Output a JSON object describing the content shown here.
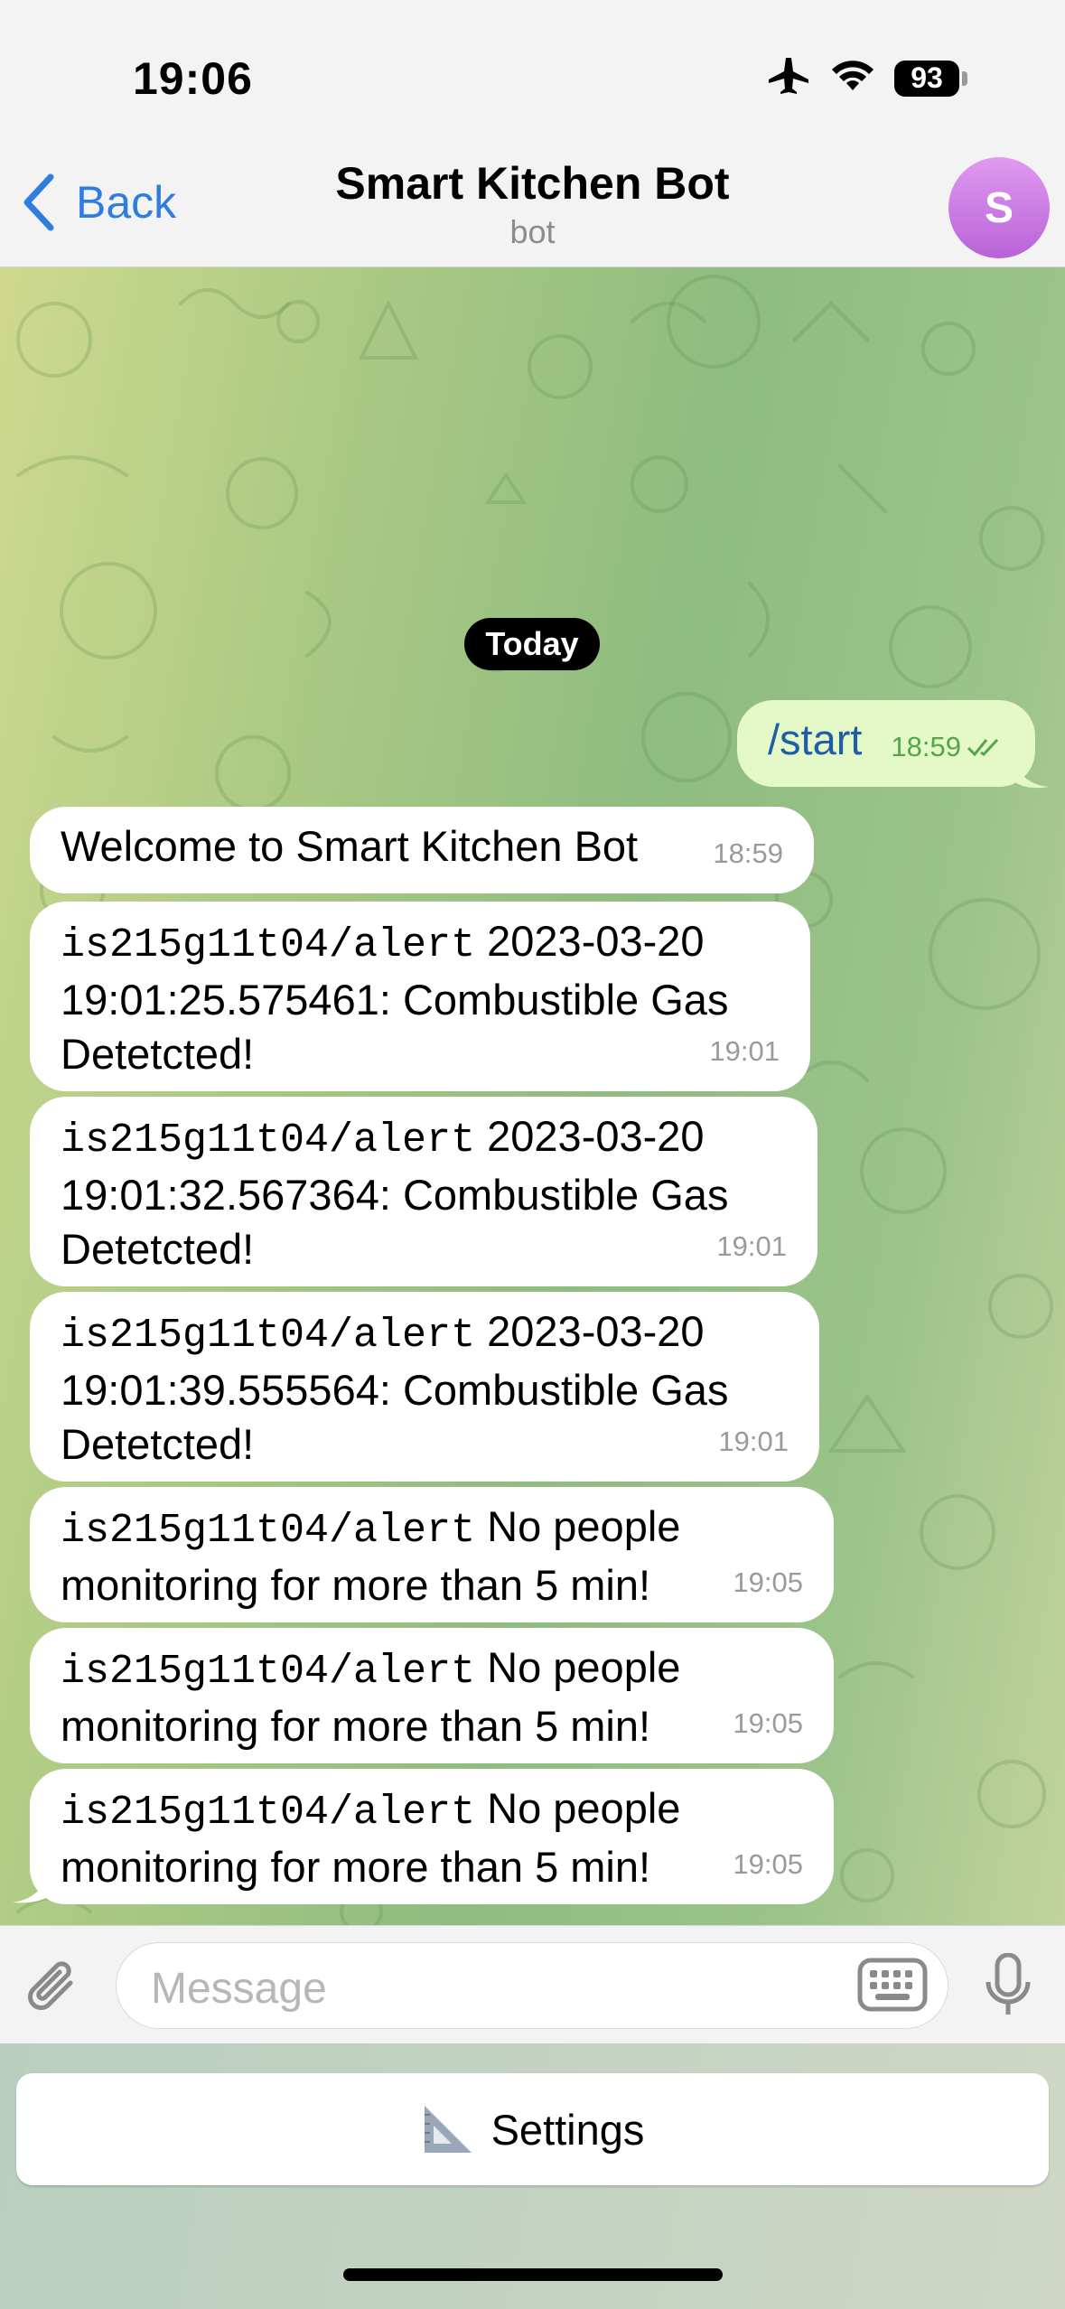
{
  "status_bar": {
    "time": "19:06",
    "battery": "93"
  },
  "nav": {
    "back_label": "Back",
    "title": "Smart Kitchen Bot",
    "subtitle": "bot",
    "avatar_letter": "S"
  },
  "chat": {
    "date_separator": "Today",
    "outgoing": {
      "text": "/start",
      "time": "18:59"
    },
    "messages": [
      {
        "text": "Welcome to Smart Kitchen Bot",
        "time": "18:59"
      },
      {
        "topic": "is215g11t04/alert",
        "line1_rest": " 2023-03-20",
        "line2": "19:01:25.575461: Combustible Gas",
        "line3": "Detetcted!",
        "time": "19:01"
      },
      {
        "topic": "is215g11t04/alert",
        "line1_rest": " 2023-03-20",
        "line2": "19:01:32.567364: Combustible Gas",
        "line3": "Detetcted!",
        "time": "19:01"
      },
      {
        "topic": "is215g11t04/alert",
        "line1_rest": " 2023-03-20",
        "line2": "19:01:39.555564: Combustible Gas",
        "line3": "Detetcted!",
        "time": "19:01"
      },
      {
        "topic": "is215g11t04/alert",
        "line1_rest": " No people",
        "line2": "monitoring for more than 5 min!",
        "time": "19:05"
      },
      {
        "topic": "is215g11t04/alert",
        "line1_rest": " No people",
        "line2": "monitoring for more than 5 min!",
        "time": "19:05"
      },
      {
        "topic": "is215g11t04/alert",
        "line1_rest": " No people",
        "line2": "monitoring for more than 5 min!",
        "time": "19:05"
      }
    ]
  },
  "input": {
    "placeholder": "Message"
  },
  "keyboard": {
    "settings_label": "Settings"
  },
  "colors": {
    "accent": "#2f7de1",
    "outgoing_bubble": "#e4f8c8",
    "avatar": "#c77ae0"
  },
  "icons": [
    "chevron-left-icon",
    "airplane-icon",
    "wifi-icon",
    "battery-icon",
    "double-check-icon",
    "paperclip-icon",
    "keyboard-icon",
    "microphone-icon",
    "triangle-ruler-icon"
  ]
}
